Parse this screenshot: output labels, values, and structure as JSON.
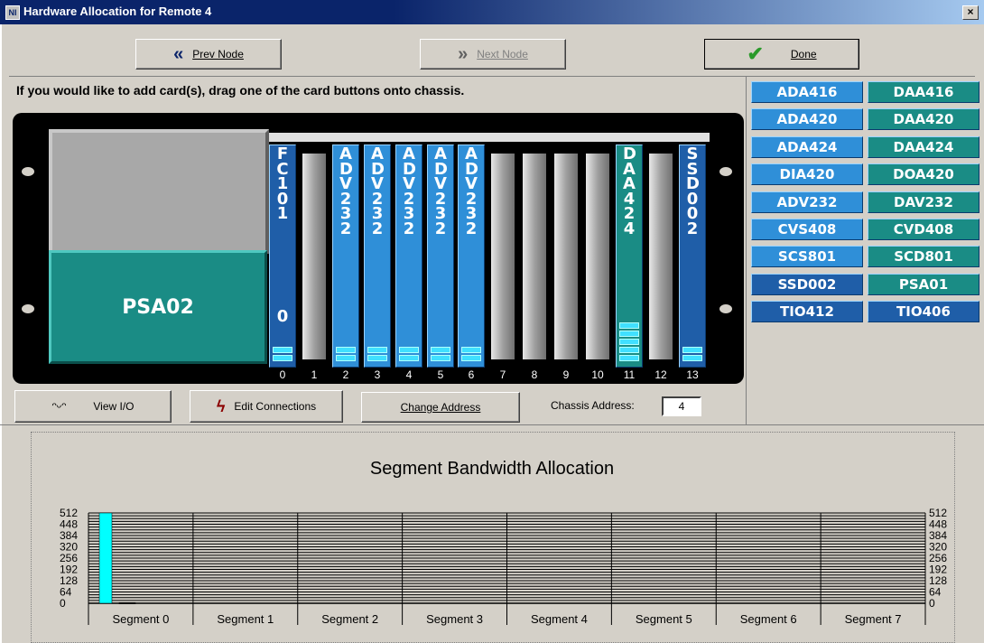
{
  "window": {
    "title": "Hardware Allocation for Remote 4",
    "close_glyph": "×"
  },
  "toolbar": {
    "prev_label": "Prev Node",
    "prev_icon": "double-chevron-left-icon",
    "next_label": "Next Node",
    "next_icon": "double-chevron-right-icon",
    "done_label": "Done",
    "done_icon": "checkmark-icon"
  },
  "instruction": "If you would like to add card(s), drag one of the card buttons onto chassis.",
  "chassis": {
    "display_panel": "",
    "power_supply": "PSA02",
    "slot_numbers": [
      "0",
      "1",
      "2",
      "3",
      "4",
      "5",
      "6",
      "7",
      "8",
      "9",
      "10",
      "11",
      "12",
      "13"
    ],
    "cards": [
      {
        "slot": 0,
        "label": "FC101",
        "label2": "0",
        "leds": 2,
        "color": "#1f5ea8"
      },
      {
        "slot": 2,
        "label": "ADV232",
        "leds": 2,
        "color": "#2f8fd8"
      },
      {
        "slot": 3,
        "label": "ADV232",
        "leds": 2,
        "color": "#2f8fd8"
      },
      {
        "slot": 4,
        "label": "ADV232",
        "leds": 2,
        "color": "#2f8fd8"
      },
      {
        "slot": 5,
        "label": "ADV232",
        "leds": 2,
        "color": "#2f8fd8"
      },
      {
        "slot": 6,
        "label": "ADV232",
        "leds": 2,
        "color": "#2f8fd8"
      },
      {
        "slot": 11,
        "label": "DAA424",
        "leds": 5,
        "color": "#1a8c85"
      },
      {
        "slot": 13,
        "label": "SSD002",
        "leds": 2,
        "color": "#1f5ea8"
      }
    ]
  },
  "palette": [
    {
      "label": "ADA416",
      "color": "#2f8fd8"
    },
    {
      "label": "DAA416",
      "color": "#1a8c85"
    },
    {
      "label": "ADA420",
      "color": "#2f8fd8"
    },
    {
      "label": "DAA420",
      "color": "#1a8c85"
    },
    {
      "label": "ADA424",
      "color": "#2f8fd8"
    },
    {
      "label": "DAA424",
      "color": "#1a8c85"
    },
    {
      "label": "DIA420",
      "color": "#2f8fd8"
    },
    {
      "label": "DOA420",
      "color": "#1a8c85"
    },
    {
      "label": "ADV232",
      "color": "#2f8fd8"
    },
    {
      "label": "DAV232",
      "color": "#1a8c85"
    },
    {
      "label": "CVS408",
      "color": "#2f8fd8"
    },
    {
      "label": "CVD408",
      "color": "#1a8c85"
    },
    {
      "label": "SCS801",
      "color": "#2f8fd8"
    },
    {
      "label": "SCD801",
      "color": "#1a8c85"
    },
    {
      "label": "SSD002",
      "color": "#1f5ea8"
    },
    {
      "label": "PSA01",
      "color": "#1a8c85"
    },
    {
      "label": "TIO412",
      "color": "#1f5ea8"
    },
    {
      "label": "TIO406",
      "color": "#1f5ea8"
    }
  ],
  "actions": {
    "view_io_label": "View I/O",
    "view_io_icon": "glasses-icon",
    "edit_conn_label": "Edit Connections",
    "edit_conn_icon": "connections-icon",
    "change_addr_label": "Change Address",
    "chassis_addr_label": "Chassis Address:",
    "chassis_addr_value": "4"
  },
  "chart_data": {
    "type": "bar",
    "title": "Segment Bandwidth Allocation",
    "categories": [
      "Segment 0",
      "Segment 1",
      "Segment 2",
      "Segment 3",
      "Segment 4",
      "Segment 5",
      "Segment 6",
      "Segment 7"
    ],
    "series": [
      {
        "values": [
          512,
          0,
          0,
          0,
          0,
          0,
          0,
          0
        ],
        "color": "#00ffff"
      },
      {
        "values": [
          4,
          0,
          0,
          0,
          0,
          0,
          0,
          0
        ],
        "color": "#000000"
      }
    ],
    "ylim": [
      0,
      512
    ],
    "yticks": [
      "0",
      "64",
      "128",
      "192",
      "256",
      "320",
      "384",
      "448",
      "512"
    ],
    "grid": true
  }
}
